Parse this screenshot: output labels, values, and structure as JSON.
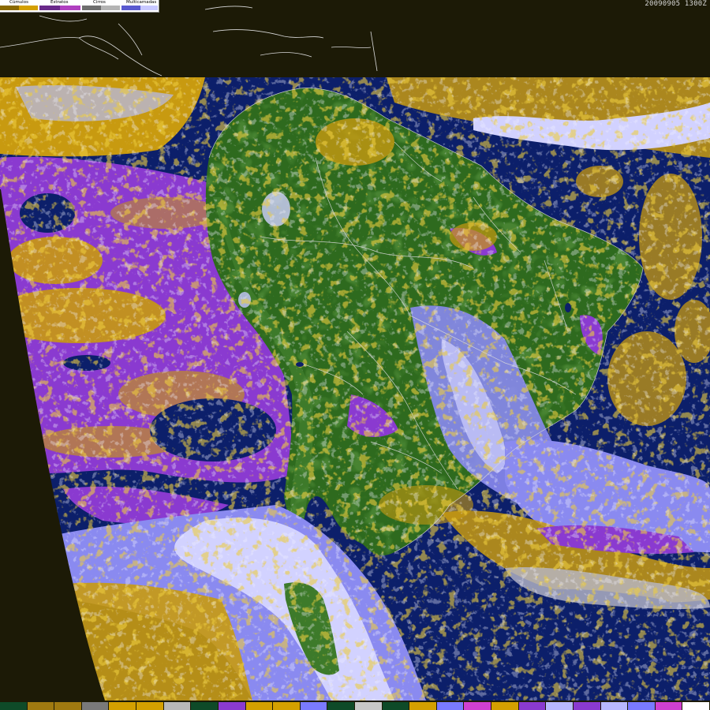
{
  "timestamp": "20090905 1300Z",
  "legend": {
    "classes": [
      {
        "name": "Cúmulos",
        "colors": [
          "#8a6a00",
          "#d4a000"
        ]
      },
      {
        "name": "Estratos",
        "colors": [
          "#6a2a8a",
          "#b040c0"
        ]
      },
      {
        "name": "Cirros",
        "colors": [
          "#6e6e6e",
          "#b4b4b4"
        ]
      },
      {
        "name": "Multicamadas",
        "colors": [
          "#5a5ad0",
          "#c8c8ff"
        ]
      }
    ]
  },
  "map_colors": {
    "space": "#1c1a06",
    "ocean": "#0c1f6a",
    "land": "#2e6a1e",
    "land_dark": "#1f5414",
    "stratus": "#8a3ad0",
    "cumulus": "#c89a10",
    "cumulus_dark": "#8a6a10",
    "multilayer": "#8a8af0",
    "multilayer_light": "#d2d2ff",
    "cirrus": "#b8b8c8",
    "border": "#d8d8d8"
  },
  "bottom_palette": [
    "#0e4a28",
    "#a07a10",
    "#a07a10",
    "#7a7a7a",
    "#d4a000",
    "#d4a000",
    "#b8b8b8",
    "#0e4a28",
    "#8a3ad0",
    "#d4a000",
    "#d4a000",
    "#7a7aff",
    "#0e4a28",
    "#c8c8c8",
    "#0e4a28",
    "#d4a000",
    "#7a7aff",
    "#d040d0",
    "#d4a000",
    "#8a3ad0",
    "#b8b8ff",
    "#8a3ad0",
    "#b8b8ff",
    "#7a7aff",
    "#d040d0",
    "#ffffff"
  ]
}
